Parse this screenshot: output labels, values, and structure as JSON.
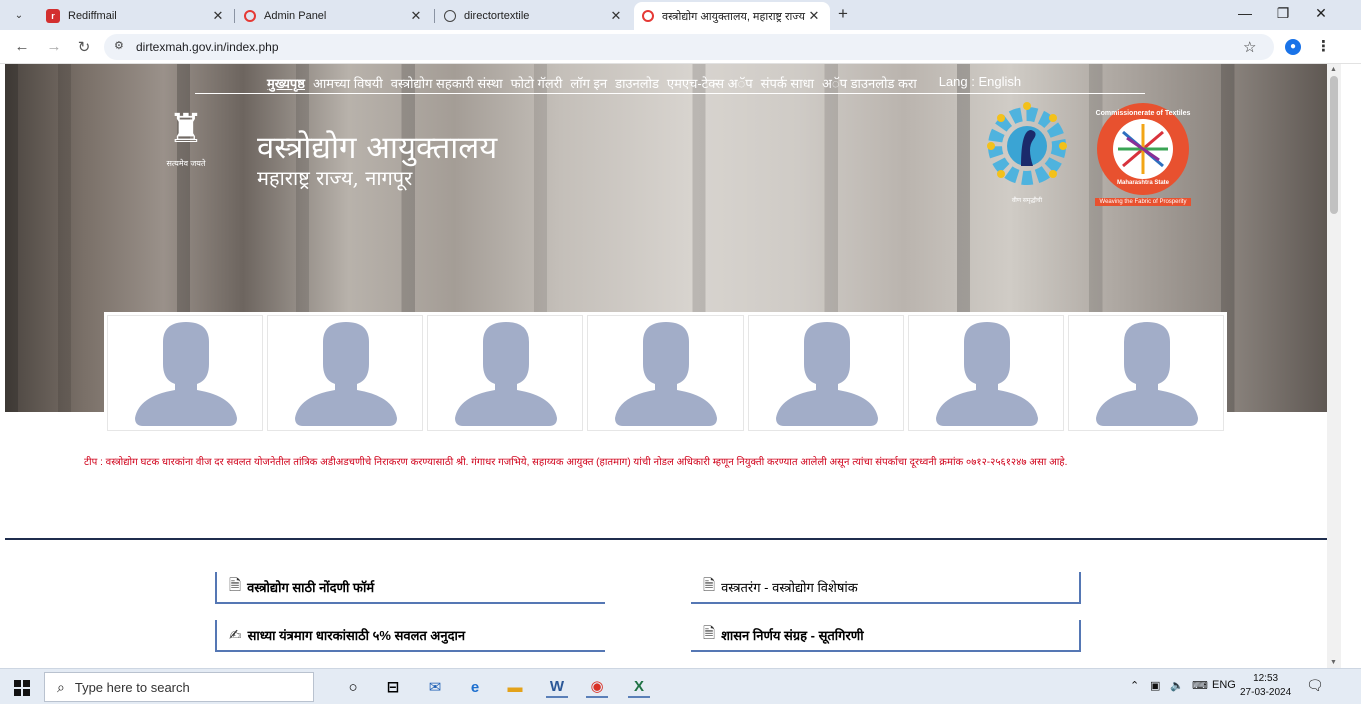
{
  "browser": {
    "tabs": [
      {
        "label": "Rediffmail",
        "active": false
      },
      {
        "label": "Admin Panel",
        "active": false
      },
      {
        "label": "directortextile",
        "active": false
      },
      {
        "label": "वस्त्रोद्योग आयुक्तालय, महाराष्ट्र राज्य",
        "active": true
      }
    ],
    "url": "dirtexmah.gov.in/index.php"
  },
  "site": {
    "menu": [
      {
        "label": "मुख्यपृष्ठ",
        "active": true
      },
      {
        "label": "आमच्या विषयी"
      },
      {
        "label": "वस्त्रोद्योग सहकारी संस्था"
      },
      {
        "label": "फोटो गॅलरी"
      },
      {
        "label": "लॉग इन"
      },
      {
        "label": "डाउनलोड"
      },
      {
        "label": "एमएच-टेक्स अॅप"
      },
      {
        "label": "संपर्क साधा"
      },
      {
        "label": "अॅप डाउनलोड करा"
      },
      {
        "label": "Lang : English"
      }
    ],
    "emblem_motto": "सत्यमेव जयते",
    "title": "वस्त्रोद्योग आयुक्तालय",
    "subtitle": "महाराष्ट्र राज्य, नागपूर",
    "logo_gear_caption": "वीण समृद्धीची",
    "logo_coe": {
      "arc_text": "Commissionerate of Textiles",
      "bottom_text": "Maharashtra State",
      "tagline": "Weaving the Fabric of Prosperity"
    },
    "notice": "टीप : वस्त्रोद्योग घटक धारकांना वीज दर सवलत योजनेतील तांत्रिक अडीअडचणीचे निराकरण करण्यासाठी श्री. गंगाधर गजभिये, सहाय्यक आयुक्त (हातमाग) यांची नोडल अधिकारी म्हणून नियुक्ती करण्यात आलेली असून त्यांचा संपर्काचा दूरध्वनी क्रमांक ०७१२-२५६१२४७ असा आहे.",
    "quick_links": [
      {
        "label": "वस्त्रोद्योग साठी नोंदणी फॉर्म",
        "icon": "document-icon"
      },
      {
        "label": "वस्त्रतरंग - वस्त्रोद्योग विशेषांक",
        "icon": "document-icon"
      },
      {
        "label": "साध्या यंत्रमाग धारकांसाठी ५% सवलत अनुदान",
        "icon": "user-edit-icon"
      },
      {
        "label": "शासन निर्णय संग्रह - सूतगिरणी",
        "icon": "document-icon"
      }
    ]
  },
  "taskbar": {
    "search_placeholder": "Type here to search",
    "lang": "ENG",
    "time": "12:53",
    "date": "27-03-2024"
  }
}
